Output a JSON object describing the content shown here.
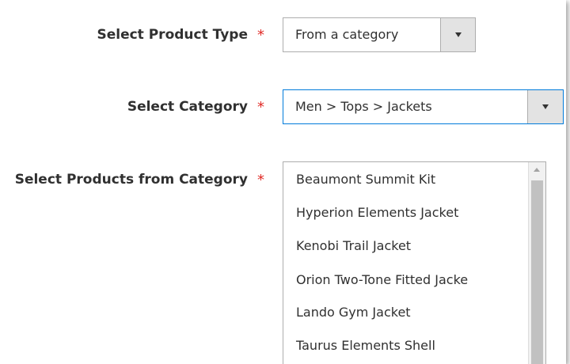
{
  "form": {
    "product_type": {
      "label": "Select Product Type",
      "required_marker": "*",
      "value": "From a category"
    },
    "category": {
      "label": "Select Category",
      "required_marker": "*",
      "value": "Men > Tops > Jackets"
    },
    "products": {
      "label": "Select Products from Category",
      "required_marker": "*",
      "options": [
        "Beaumont Summit Kit",
        "Hyperion Elements Jacket",
        "Kenobi Trail Jacket",
        "Orion Two-Tone Fitted Jacke",
        "Lando Gym Jacket",
        "Taurus Elements Shell"
      ]
    }
  },
  "colors": {
    "required": "#e02b27",
    "focus_border": "#007bdb",
    "label_text": "#303030"
  },
  "icons": {
    "dropdown": "chevron-down-icon",
    "scroll_up": "scroll-up-arrow-icon"
  }
}
